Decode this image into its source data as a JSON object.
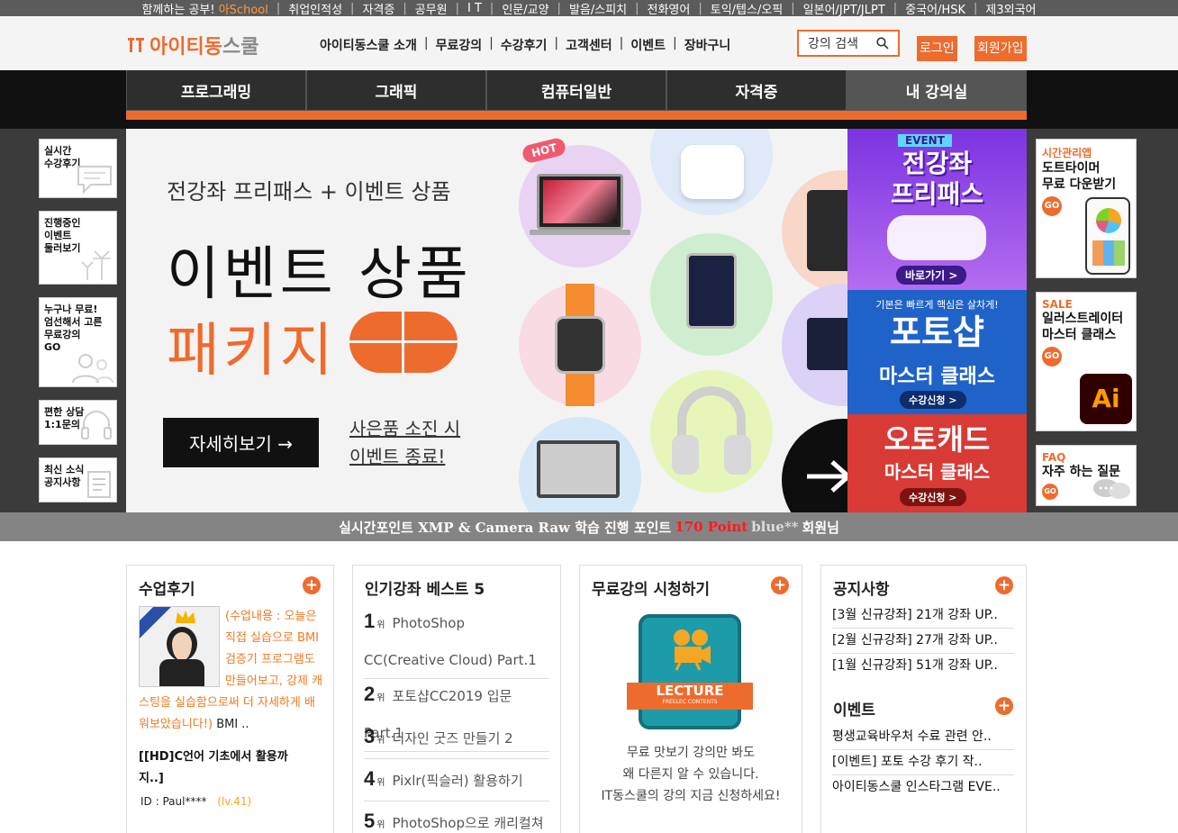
{
  "topbar": {
    "intro": "함께하는 공부!",
    "brand": "아School",
    "items": [
      "취업인적성",
      "자격증",
      "공무원",
      "I T",
      "인문/교양",
      "발음/스피치",
      "전화영어",
      "토익/텝스/오픽",
      "일본어/JPT/JLPT",
      "중국어/HSK",
      "제3외국어"
    ]
  },
  "header": {
    "logo_brand": "아이티동",
    "logo_suffix": "스쿨",
    "nav": [
      "아이티동스쿨 소개",
      "무료강의",
      "수강후기",
      "고객센터",
      "이벤트",
      "장바구니"
    ],
    "search_placeholder": "강의 검색",
    "login": "로그인",
    "join": "회원가입"
  },
  "categories": [
    "프로그래밍",
    "그래픽",
    "컴퓨터일반",
    "자격증",
    "내 강의실"
  ],
  "left_quick": [
    {
      "label": "실시간\n수강후기"
    },
    {
      "label": "진행중인\n이벤트\n둘러보기"
    },
    {
      "label": "누구나 무료!\n엄선해서 고른\n무료강의\nGO"
    },
    {
      "label": "편한 상담\n1:1문의"
    },
    {
      "label": "최신 소식\n공지사항"
    }
  ],
  "main_banner": {
    "subtitle": "전강좌 프리패스 + 이벤트 상품",
    "title": "이벤트 상품",
    "title2": "패키지",
    "hot": "HOT",
    "button": "자세히보기 →",
    "note1": "사은품 소진 시",
    "note2": "이벤트 종료!"
  },
  "side_ads": [
    {
      "tag": "EVENT",
      "title": "전강좌\n프리패스",
      "cta": "바로가기 >",
      "color": "#8f3fe6"
    },
    {
      "tag": "기본은 빠르게 핵심은 살차게!",
      "title": "포토샵",
      "sub": "마스터 클래스",
      "cta": "수강신청 >",
      "color": "#1f63c9"
    },
    {
      "title": "오토캐드",
      "sub": "마스터 클래스",
      "cta": "수강신청 >",
      "color": "#d83a36"
    }
  ],
  "right_quick": [
    {
      "t1": "시간관리앱",
      "t2": "도트타이머\n무료 다운받기",
      "go": "GO"
    },
    {
      "t1": "SALE",
      "t2": "일러스트레이터\n마스터 클래스",
      "go": "GO",
      "icon": "Ai"
    },
    {
      "t1": "FAQ",
      "t2": "자주 하는 질문",
      "go": "GO"
    }
  ],
  "ticker": {
    "prefix": "실시간포인트 XMP & Camera Raw 학습 진행 포인트",
    "points": "170 Point",
    "user": "blue**",
    "suffix": "회원님"
  },
  "reviews": {
    "title": "수업후기",
    "text": "(수업내용 : 오늘은 직접 실습으로 BMI 검증기 프로그램도 만들어보고, 강제 캐스팅을 실습함으로써 더 자세하게 배워보았습니다!)",
    "text_tail": "BMI ..",
    "course": "[[HD]C언어 기초에서 활용까지..]",
    "id": "ID : Paul****",
    "level": "(lv.41)"
  },
  "best": {
    "title": "인기강좌 베스트 5",
    "rank_suffix": "위",
    "items": [
      {
        "rank": "1",
        "name": "PhotoShop CC(Creative Cloud) Part.1"
      },
      {
        "rank": "2",
        "name": "포토샵CC2019 입문Part.1"
      },
      {
        "rank": "3",
        "name": "디자인 굿즈 만들기 2"
      },
      {
        "rank": "4",
        "name": "Pixlr(픽슬러) 활용하기"
      },
      {
        "rank": "5",
        "name": "PhotoShop으로 캐리컬쳐"
      }
    ]
  },
  "free": {
    "title": "무료강의 시청하기",
    "badge": "LECTURE",
    "badge_sub": "FREELEC CONTENTS",
    "line1": "무료 맛보기 강의만 봐도",
    "line2": "왜 다른지 알 수 있습니다.",
    "line3": "IT동스쿨의 강의 지금 신청하세요!"
  },
  "notice": {
    "title": "공지사항",
    "items": [
      "[3월 신규강좌] 21개 강좌 UP..",
      "[2월 신규강좌] 27개 강좌 UP..",
      "[1월 신규강좌] 51개 강좌 UP.."
    ]
  },
  "event": {
    "title": "이벤트",
    "items": [
      "평생교육바우처 수료 관련 안..",
      "[이벤트] 포토 수강 후기 작..",
      "아이티동스쿨 인스타그램 EVE.."
    ]
  },
  "colors": {
    "accent": "#ee6b2e",
    "dark": "#111111",
    "ticker": "#848484"
  }
}
